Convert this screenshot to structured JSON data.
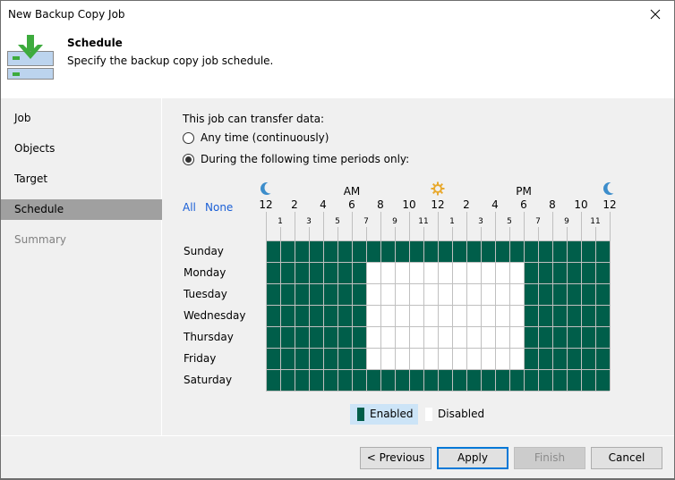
{
  "window": {
    "title": "New Backup Copy Job",
    "close_icon": "close-icon"
  },
  "header": {
    "icon": "backup-copy-job-icon",
    "title": "Schedule",
    "subtitle": "Specify the backup copy job schedule."
  },
  "sidebar": {
    "items": [
      {
        "label": "Job",
        "state": "normal"
      },
      {
        "label": "Objects",
        "state": "normal"
      },
      {
        "label": "Target",
        "state": "normal"
      },
      {
        "label": "Schedule",
        "state": "active"
      },
      {
        "label": "Summary",
        "state": "disabled"
      }
    ]
  },
  "schedule": {
    "prompt": "This job can transfer data:",
    "options": [
      {
        "label": "Any time (continuously)",
        "selected": false
      },
      {
        "label": "During the following time periods only:",
        "selected": true
      }
    ],
    "select_all": "All",
    "select_none": "None",
    "am_label": "AM",
    "pm_label": "PM",
    "icons": {
      "midnight_start": "moon-icon",
      "noon": "sun-icon",
      "midnight_end": "moon-icon"
    },
    "major_hours": [
      "12",
      "2",
      "4",
      "6",
      "8",
      "10",
      "12",
      "2",
      "4",
      "6",
      "8",
      "10",
      "12"
    ],
    "minor_hours": [
      "1",
      "3",
      "5",
      "7",
      "9",
      "11",
      "1",
      "3",
      "5",
      "7",
      "9",
      "11"
    ],
    "days": [
      "Sunday",
      "Monday",
      "Tuesday",
      "Wednesday",
      "Thursday",
      "Friday",
      "Saturday"
    ],
    "disabled_ranges": [
      {
        "days": [
          "Monday",
          "Tuesday",
          "Wednesday",
          "Thursday",
          "Friday"
        ],
        "from_hour": 7,
        "to_hour": 18
      }
    ],
    "colors": {
      "enabled": "#005e4a",
      "disabled": "#ffffff",
      "grid": "#c0c0c0"
    },
    "legend": {
      "enabled": "Enabled",
      "disabled": "Disabled"
    }
  },
  "buttons": {
    "previous": "< Previous",
    "apply": "Apply",
    "finish": "Finish",
    "cancel": "Cancel"
  }
}
